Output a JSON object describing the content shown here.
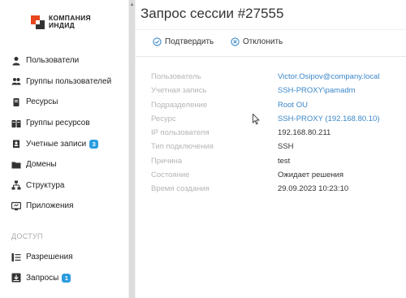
{
  "logo": {
    "line1": "КОМПАНИЯ",
    "line2": "ИНДИД"
  },
  "sidebar": {
    "items": [
      {
        "label": "Пользователи",
        "icon": "user-icon"
      },
      {
        "label": "Группы пользователей",
        "icon": "users-icon"
      },
      {
        "label": "Ресурсы",
        "icon": "server-icon"
      },
      {
        "label": "Группы ресурсов",
        "icon": "server-group-icon"
      },
      {
        "label": "Учетные записи",
        "icon": "account-icon",
        "badge": "3"
      },
      {
        "label": "Домены",
        "icon": "folder-icon"
      },
      {
        "label": "Структура",
        "icon": "structure-icon"
      },
      {
        "label": "Приложения",
        "icon": "app-icon"
      }
    ],
    "section_label": "ДОСТУП",
    "access_items": [
      {
        "label": "Разрешения",
        "icon": "permissions-icon"
      },
      {
        "label": "Запросы",
        "icon": "requests-icon",
        "badge": "1"
      }
    ]
  },
  "main": {
    "title": "Запрос сессии #27555",
    "confirm_label": "Подтвердить",
    "reject_label": "Отклонить",
    "details": [
      {
        "key": "Пользователь",
        "value": "Victor.Osipov@company.local",
        "link": true
      },
      {
        "key": "Учетная запись",
        "value": "SSH-PROXY\\pamadm",
        "link": true
      },
      {
        "key": "Подразделение",
        "value": "Root OU",
        "link": true
      },
      {
        "key": "Ресурс",
        "value": "SSH-PROXY (192.168.80.10)",
        "link": true
      },
      {
        "key": "IP пользователя",
        "value": "192.168.80.211",
        "link": false
      },
      {
        "key": "Тип подключения",
        "value": "SSH",
        "link": false
      },
      {
        "key": "Причина",
        "value": "test",
        "link": false
      },
      {
        "key": "Состояние",
        "value": "Ожидает решения",
        "link": false
      },
      {
        "key": "Время создания",
        "value": "29.09.2023 10:23:10",
        "link": false
      }
    ]
  },
  "colors": {
    "accent": "#3b87c9",
    "badge": "#2b9de0",
    "logo": "#e8451e"
  }
}
